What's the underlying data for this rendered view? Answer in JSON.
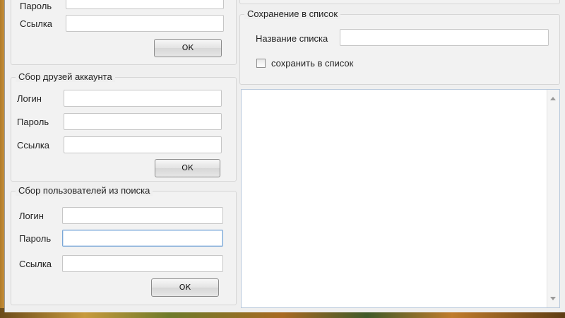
{
  "group1": {
    "password_label": "Пароль",
    "link_label": "Ссылка",
    "ok_label": "ОК"
  },
  "group2": {
    "title": "Сбор друзей аккаунта",
    "login_label": "Логин",
    "password_label": "Пароль",
    "link_label": "Ссылка",
    "ok_label": "ОК"
  },
  "group3": {
    "title": "Сбор пользователей из поиска",
    "login_label": "Логин",
    "password_label": "Пароль",
    "link_label": "Ссылка",
    "ok_label": "ОК"
  },
  "save": {
    "title": "Сохранение в список",
    "list_name_label": "Название списка",
    "checkbox_label": "сохранить в список",
    "checkbox_checked": false
  },
  "colors": {
    "window_bg": "#efefef",
    "focus_border": "#7aa7d6"
  }
}
